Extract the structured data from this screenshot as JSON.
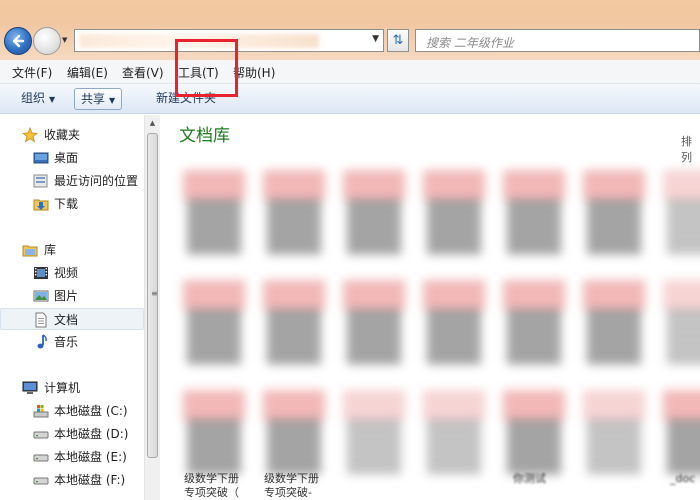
{
  "search": {
    "placeholder": "搜索 二年级作业"
  },
  "menu": {
    "file": "文件(F)",
    "edit": "编辑(E)",
    "view": "查看(V)",
    "tools": "工具(T)",
    "help": "帮助(H)"
  },
  "toolbar": {
    "organize": "组织",
    "share": "共享",
    "new_folder": "新建文件夹"
  },
  "nav": {
    "favorites": "收藏夹",
    "desktop": "桌面",
    "recent": "最近访问的位置",
    "downloads": "下载",
    "libraries": "库",
    "videos": "视频",
    "pictures": "图片",
    "documents": "文档",
    "music": "音乐",
    "computer": "计算机",
    "disk_c": "本地磁盘 (C:)",
    "disk_d": "本地磁盘 (D:)",
    "disk_e": "本地磁盘 (E:)",
    "disk_f": "本地磁盘 (F:)"
  },
  "content": {
    "title": "文档库",
    "arrange": "排列",
    "captions": [
      {
        "line1": "级数学下册",
        "line2": "专项突破（"
      },
      {
        "line1": "级数学下册",
        "line2": "专项突破-"
      },
      {
        "line1": "你测试",
        "line2": ""
      },
      {
        "line1": "_doc",
        "line2": ""
      }
    ]
  },
  "colors": {
    "highlight_box": "#e8232f",
    "library_title": "#1e7b1e"
  }
}
